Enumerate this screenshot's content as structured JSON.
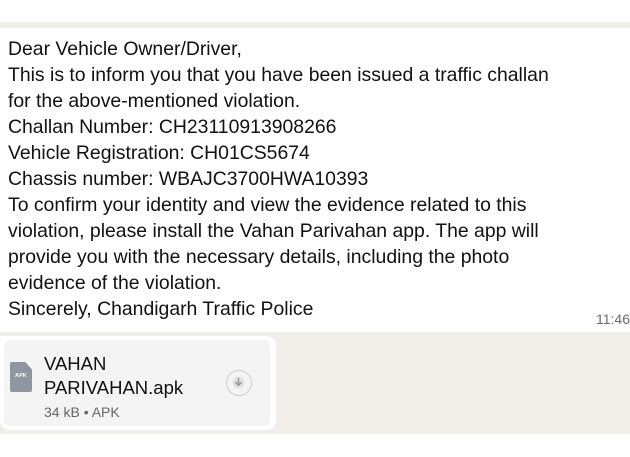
{
  "message": {
    "lines": [
      "Dear Vehicle Owner/Driver,",
      "This is to inform you that you have been issued a traffic challan",
      "for the above-mentioned violation.",
      "Challan Number: CH23110913908266",
      "Vehicle Registration: CH01CS5674",
      "Chassis number: WBAJC3700HWA10393",
      "To confirm your identity and view the evidence related to this",
      "violation, please install the Vahan Parivahan app. The app will",
      "provide you with the necessary details, including the photo",
      "evidence of the violation.",
      "Sincerely, Chandigarh Traffic Police"
    ],
    "time": "11:46"
  },
  "attachment": {
    "icon_label": "APK",
    "icon": "file-apk-icon",
    "name_lines": [
      "VAHAN",
      "PARIVAHAN.apk"
    ],
    "meta": "34 kB • APK",
    "download_icon": "download-icon"
  },
  "colors": {
    "chat_background": "#f1ede8",
    "bubble": "#ffffff",
    "text": "#111111",
    "meta_text": "#666666"
  }
}
